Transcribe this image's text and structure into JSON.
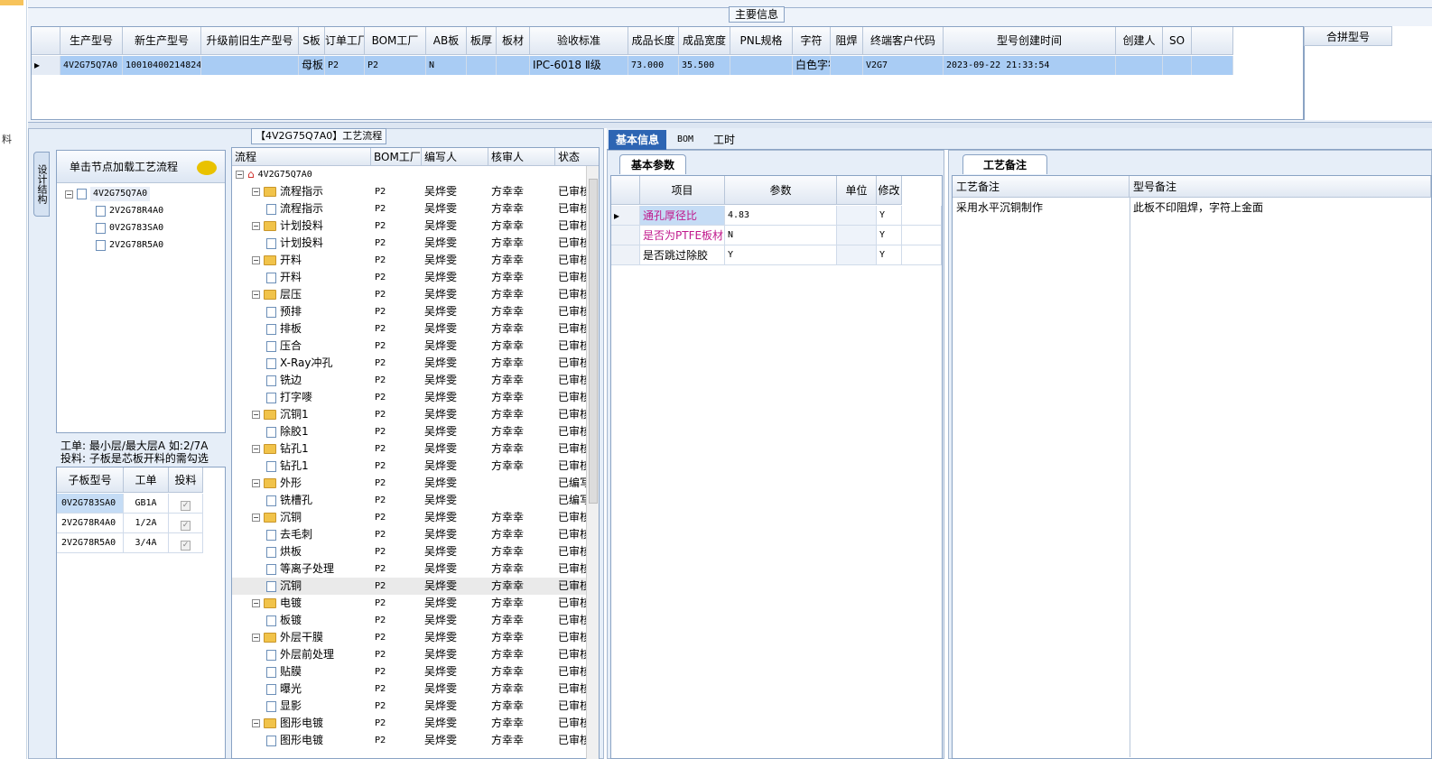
{
  "left_strip": {
    "glyph": "料"
  },
  "main": {
    "title": "主要信息",
    "columns": [
      "生产型号",
      "新生产型号",
      "升级前旧生产型号",
      "S板",
      "订单工厂",
      "BOM工厂",
      "AB板",
      "板厚",
      "板材",
      "验收标准",
      "成品长度",
      "成品宽度",
      "PNL规格",
      "字符",
      "阻焊",
      "终端客户代码",
      "型号创建时间",
      "创建人",
      "SO"
    ],
    "row": [
      "4V2G75Q7A0",
      "10010400214824",
      "",
      "母板",
      "P2",
      "P2",
      "N",
      "",
      "",
      "IPC-6018 Ⅱ级",
      "73.000",
      "35.500",
      "",
      "白色字符",
      "",
      "V2G7",
      "2023-09-22 21:33:54",
      "",
      ""
    ],
    "merge_header": "合拼型号"
  },
  "process": {
    "title": "【4V2G75Q7A0】工艺流程",
    "vertical_tab": "设计结构",
    "load_hint": "单击节点加载工艺流程",
    "tree": [
      "4V2G75Q7A0",
      "2V2G78R4A0",
      "0V2G783SA0",
      "2V2G78R5A0"
    ],
    "note_line1": "工单: 最小层/最大层A 如:2/7A",
    "note_line2": "投料: 子板是芯板开料的需勾选",
    "sub_columns": [
      "子板型号",
      "工单",
      "投料"
    ],
    "sub_rows": [
      {
        "model": "0V2G783SA0",
        "order": "GB1A"
      },
      {
        "model": "2V2G78R4A0",
        "order": "1/2A"
      },
      {
        "model": "2V2G78R5A0",
        "order": "3/4A"
      }
    ],
    "flow_columns": [
      "流程",
      "BOM工厂",
      "编写人",
      "核审人",
      "状态"
    ],
    "flow_root": "4V2G75Q7A0",
    "flow_rows": [
      {
        "name": "流程指示",
        "type": "folder",
        "bom": "P2",
        "writer": "吴烨雯",
        "reviewer": "方幸幸",
        "status": "已审核"
      },
      {
        "name": "流程指示",
        "type": "doc",
        "bom": "P2",
        "writer": "吴烨雯",
        "reviewer": "方幸幸",
        "status": "已审核"
      },
      {
        "name": "计划投料",
        "type": "folder",
        "bom": "P2",
        "writer": "吴烨雯",
        "reviewer": "方幸幸",
        "status": "已审核"
      },
      {
        "name": "计划投料",
        "type": "doc",
        "bom": "P2",
        "writer": "吴烨雯",
        "reviewer": "方幸幸",
        "status": "已审核"
      },
      {
        "name": "开料",
        "type": "folder",
        "bom": "P2",
        "writer": "吴烨雯",
        "reviewer": "方幸幸",
        "status": "已审核"
      },
      {
        "name": "开料",
        "type": "doc",
        "bom": "P2",
        "writer": "吴烨雯",
        "reviewer": "方幸幸",
        "status": "已审核"
      },
      {
        "name": "层压",
        "type": "folder",
        "bom": "P2",
        "writer": "吴烨雯",
        "reviewer": "方幸幸",
        "status": "已审核"
      },
      {
        "name": "预排",
        "type": "doc",
        "bom": "P2",
        "writer": "吴烨雯",
        "reviewer": "方幸幸",
        "status": "已审核"
      },
      {
        "name": "排板",
        "type": "doc",
        "bom": "P2",
        "writer": "吴烨雯",
        "reviewer": "方幸幸",
        "status": "已审核"
      },
      {
        "name": "压合",
        "type": "doc",
        "bom": "P2",
        "writer": "吴烨雯",
        "reviewer": "方幸幸",
        "status": "已审核"
      },
      {
        "name": "X-Ray冲孔",
        "type": "doc",
        "bom": "P2",
        "writer": "吴烨雯",
        "reviewer": "方幸幸",
        "status": "已审核"
      },
      {
        "name": "铣边",
        "type": "doc",
        "bom": "P2",
        "writer": "吴烨雯",
        "reviewer": "方幸幸",
        "status": "已审核"
      },
      {
        "name": "打字嘜",
        "type": "doc",
        "bom": "P2",
        "writer": "吴烨雯",
        "reviewer": "方幸幸",
        "status": "已审核"
      },
      {
        "name": "沉铜1",
        "type": "folder",
        "bom": "P2",
        "writer": "吴烨雯",
        "reviewer": "方幸幸",
        "status": "已审核"
      },
      {
        "name": "除胶1",
        "type": "doc",
        "bom": "P2",
        "writer": "吴烨雯",
        "reviewer": "方幸幸",
        "status": "已审核"
      },
      {
        "name": "钻孔1",
        "type": "folder",
        "bom": "P2",
        "writer": "吴烨雯",
        "reviewer": "方幸幸",
        "status": "已审核"
      },
      {
        "name": "钻孔1",
        "type": "doc",
        "bom": "P2",
        "writer": "吴烨雯",
        "reviewer": "方幸幸",
        "status": "已审核"
      },
      {
        "name": "外形",
        "type": "folder",
        "bom": "P2",
        "writer": "吴烨雯",
        "reviewer": "",
        "status": "已编写"
      },
      {
        "name": "铣槽孔",
        "type": "doc",
        "bom": "P2",
        "writer": "吴烨雯",
        "reviewer": "",
        "status": "已编写"
      },
      {
        "name": "沉铜",
        "type": "folder",
        "bom": "P2",
        "writer": "吴烨雯",
        "reviewer": "方幸幸",
        "status": "已审核"
      },
      {
        "name": "去毛刺",
        "type": "doc",
        "bom": "P2",
        "writer": "吴烨雯",
        "reviewer": "方幸幸",
        "status": "已审核"
      },
      {
        "name": "烘板",
        "type": "doc",
        "bom": "P2",
        "writer": "吴烨雯",
        "reviewer": "方幸幸",
        "status": "已审核"
      },
      {
        "name": "等离子处理",
        "type": "doc",
        "bom": "P2",
        "writer": "吴烨雯",
        "reviewer": "方幸幸",
        "status": "已审核"
      },
      {
        "name": "沉铜",
        "type": "doc",
        "bom": "P2",
        "writer": "吴烨雯",
        "reviewer": "方幸幸",
        "status": "已审核",
        "selected": true
      },
      {
        "name": "电镀",
        "type": "folder",
        "bom": "P2",
        "writer": "吴烨雯",
        "reviewer": "方幸幸",
        "status": "已审核"
      },
      {
        "name": "板镀",
        "type": "doc",
        "bom": "P2",
        "writer": "吴烨雯",
        "reviewer": "方幸幸",
        "status": "已审核"
      },
      {
        "name": "外层干膜",
        "type": "folder",
        "bom": "P2",
        "writer": "吴烨雯",
        "reviewer": "方幸幸",
        "status": "已审核"
      },
      {
        "name": "外层前处理",
        "type": "doc",
        "bom": "P2",
        "writer": "吴烨雯",
        "reviewer": "方幸幸",
        "status": "已审核"
      },
      {
        "name": "贴膜",
        "type": "doc",
        "bom": "P2",
        "writer": "吴烨雯",
        "reviewer": "方幸幸",
        "status": "已审核"
      },
      {
        "name": "曝光",
        "type": "doc",
        "bom": "P2",
        "writer": "吴烨雯",
        "reviewer": "方幸幸",
        "status": "已审核"
      },
      {
        "name": "显影",
        "type": "doc",
        "bom": "P2",
        "writer": "吴烨雯",
        "reviewer": "方幸幸",
        "status": "已审核"
      },
      {
        "name": "图形电镀",
        "type": "folder",
        "bom": "P2",
        "writer": "吴烨雯",
        "reviewer": "方幸幸",
        "status": "已审核"
      },
      {
        "name": "图形电镀",
        "type": "doc",
        "bom": "P2",
        "writer": "吴烨雯",
        "reviewer": "方幸幸",
        "status": "已审核"
      }
    ]
  },
  "tabs": [
    "基本信息",
    "BOM",
    "工时"
  ],
  "basic": {
    "tab": "基本参数",
    "columns": [
      "项目",
      "参数",
      "单位",
      "修改"
    ],
    "rows": [
      {
        "item": "通孔厚径比",
        "value": "4.83",
        "unit": "",
        "edit": "Y",
        "color": "#c0188c"
      },
      {
        "item": "是否为PTFE板材",
        "value": "N",
        "unit": "",
        "edit": "Y",
        "color": "#c0188c"
      },
      {
        "item": "是否跳过除胶",
        "value": "Y",
        "unit": "",
        "edit": "Y",
        "color": "#000000"
      }
    ]
  },
  "remarks": {
    "tab": "工艺备注",
    "process_header": "工艺备注",
    "model_header": "型号备注",
    "process_text": "采用水平沉铜制作",
    "model_text": "此板不印阻焊，字符上金面"
  }
}
